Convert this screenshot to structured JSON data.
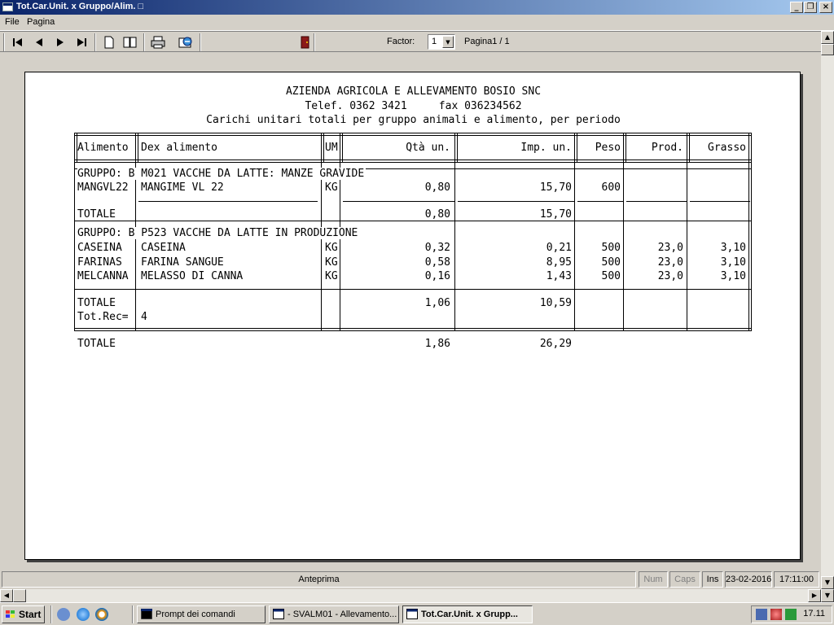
{
  "window": {
    "title": "Tot.Car.Unit. x Gruppo/Alim. □",
    "min_glyph": "_",
    "restore_glyph": "❐",
    "close_glyph": "×"
  },
  "menu": {
    "file": "File",
    "pagina": "Pagina"
  },
  "toolbar": {
    "icons": [
      "first-page-icon",
      "prev-page-icon",
      "next-page-icon",
      "last-page-icon",
      "single-page-icon",
      "two-pages-icon",
      "print-icon",
      "export-icon",
      "exit-door-icon"
    ],
    "factor_label": "Factor:",
    "factor_value": "1",
    "page_label": "Pagina1 / 1"
  },
  "report": {
    "header": {
      "company": "AZIENDA AGRICOLA E ALLEVAMENTO BOSIO SNC",
      "contacts": "Telef. 0362 3421     fax 036234562",
      "subtitle": "Carichi unitari totali per gruppo animali e alimento, per periodo"
    },
    "columns": [
      "Alimento",
      "Dex alimento",
      "UM",
      "Qtà un.",
      "Imp. un.",
      "Peso",
      "Prod.",
      "Grasso"
    ],
    "groups": [
      {
        "title": "GRUPPO: B M021 VACCHE DA LATTE: MANZE GRAVIDE",
        "rows": [
          {
            "code": "MANGVL22",
            "desc": "MANGIME VL 22",
            "um": "KG",
            "qta": "0,80",
            "imp": "15,70",
            "peso": "600",
            "prod": "",
            "grasso": ""
          }
        ],
        "total_label": "TOTALE",
        "total_qta": "0,80",
        "total_imp": "15,70"
      },
      {
        "title": "GRUPPO: B P523 VACCHE DA LATTE IN PRODUZIONE",
        "rows": [
          {
            "code": "CASEINA",
            "desc": "CASEINA",
            "um": "KG",
            "qta": "0,32",
            "imp": "0,21",
            "peso": "500",
            "prod": "23,0",
            "grasso": "3,10"
          },
          {
            "code": "FARINAS",
            "desc": "FARINA SANGUE",
            "um": "KG",
            "qta": "0,58",
            "imp": "8,95",
            "peso": "500",
            "prod": "23,0",
            "grasso": "3,10"
          },
          {
            "code": "MELCANNA",
            "desc": "MELASSO DI CANNA",
            "um": "KG",
            "qta": "0,16",
            "imp": "1,43",
            "peso": "500",
            "prod": "23,0",
            "grasso": "3,10"
          }
        ],
        "total_label": "TOTALE",
        "total_qta": "1,06",
        "total_imp": "10,59",
        "rec_label": "Tot.Rec=",
        "rec_value": "4"
      }
    ],
    "grand_total_label": "TOTALE",
    "grand_total_qta": "1,86",
    "grand_total_imp": "26,29"
  },
  "status": {
    "mode": "Anteprima",
    "num": "Num",
    "caps": "Caps",
    "ins": "Ins",
    "date": "23-02-2016",
    "time": "17:11:00"
  },
  "taskbar": {
    "start": "Start",
    "tasks": [
      {
        "label": "Prompt dei comandi"
      },
      {
        "label": "- SVALM01 - Allevamento..."
      },
      {
        "label": "Tot.Car.Unit. x Grupp..."
      }
    ],
    "clock": "17.11"
  },
  "colors": {
    "titlebar_start": "#0a246a",
    "titlebar_end": "#a6caf0",
    "chrome": "#d4d0c8"
  }
}
